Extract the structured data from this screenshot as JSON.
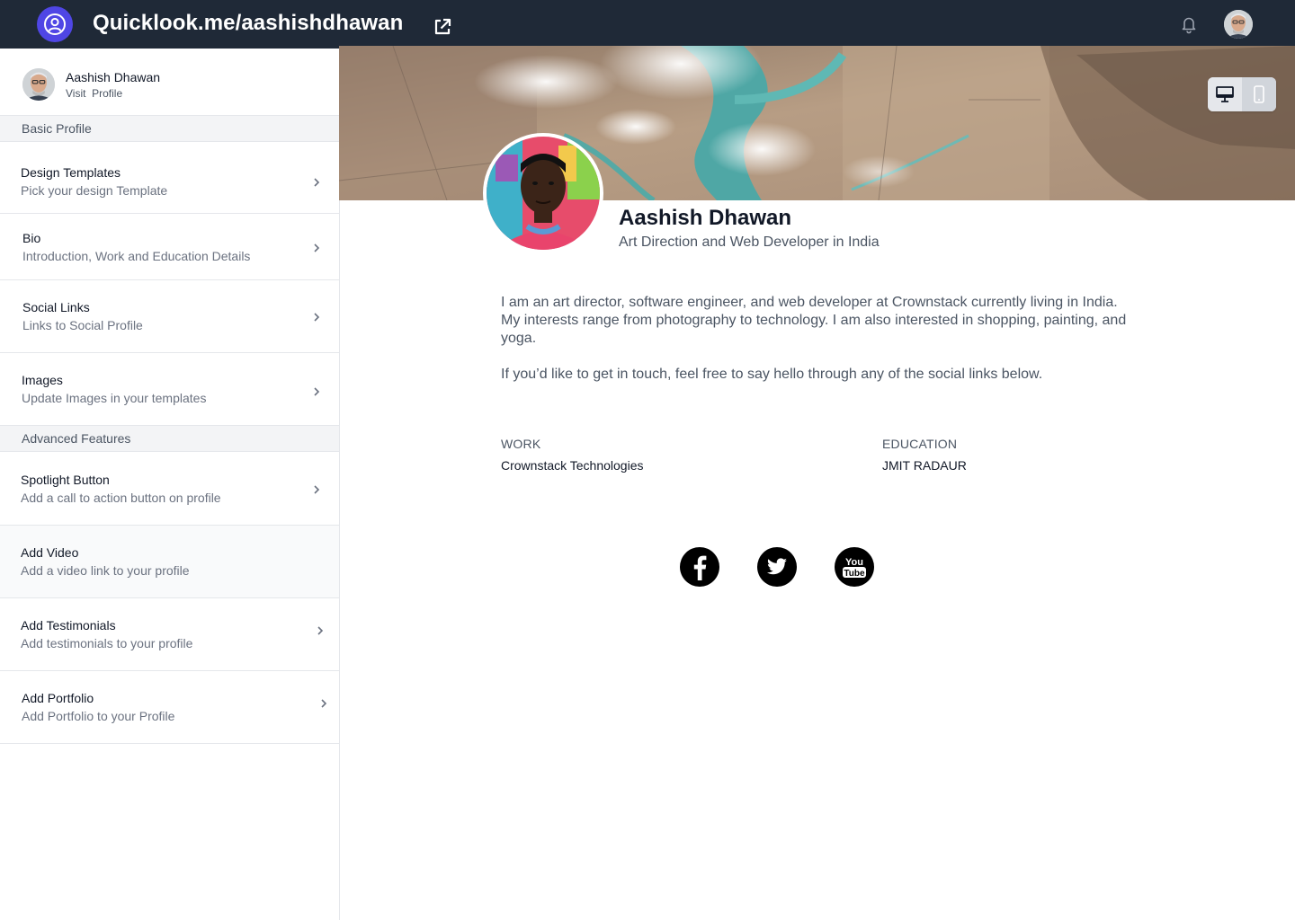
{
  "topbar": {
    "site_url": "Quicklook.me/aashishdhawan",
    "icons": [
      "logo-icon",
      "external-link-icon",
      "bell-icon",
      "avatar"
    ],
    "bg_color": "#1f2937",
    "logo_color": "#4f46e5"
  },
  "sidebar": {
    "user": {
      "name": "Aashish Dhawan",
      "visit_label": "Visit  Profile"
    },
    "sections": [
      {
        "label": "Basic Profile"
      },
      {
        "label": "Advanced Features"
      }
    ],
    "items": [
      {
        "title": "Design Templates",
        "subtitle": "Pick your design Template"
      },
      {
        "title": "Bio",
        "subtitle": "Introduction, Work and Education Details"
      },
      {
        "title": "Social Links",
        "subtitle": "Links to Social Profile"
      },
      {
        "title": "Images",
        "subtitle": "Update Images in your templates"
      },
      {
        "title": "Spotlight Button",
        "subtitle": "Add a call to action button on profile"
      },
      {
        "title": "Add Video",
        "subtitle": "Add a video link to your profile"
      },
      {
        "title": "Add Testimonials",
        "subtitle": "Add testimonials to your profile"
      },
      {
        "title": "Add Portfolio",
        "subtitle": "Add Portfolio to your Profile"
      }
    ]
  },
  "preview": {
    "name": "Aashish Dhawan",
    "role": "Art Direction and Web Developer in India",
    "bio": [
      "I am an art director, software engineer, and web developer at Crownstack currently living in India. My interests range from photography to technology. I am also interested in shopping, painting, and yoga.",
      "If you’d like to get in touch, feel free to say hello through any of the social links below."
    ],
    "work_label": "WORK",
    "work_value": "Crownstack Technologies",
    "education_label": "EDUCATION",
    "education_value": "JMIT RADAUR",
    "social": [
      "facebook-icon",
      "twitter-icon",
      "youtube-icon"
    ],
    "view_modes": [
      "desktop-icon",
      "mobile-icon"
    ]
  }
}
